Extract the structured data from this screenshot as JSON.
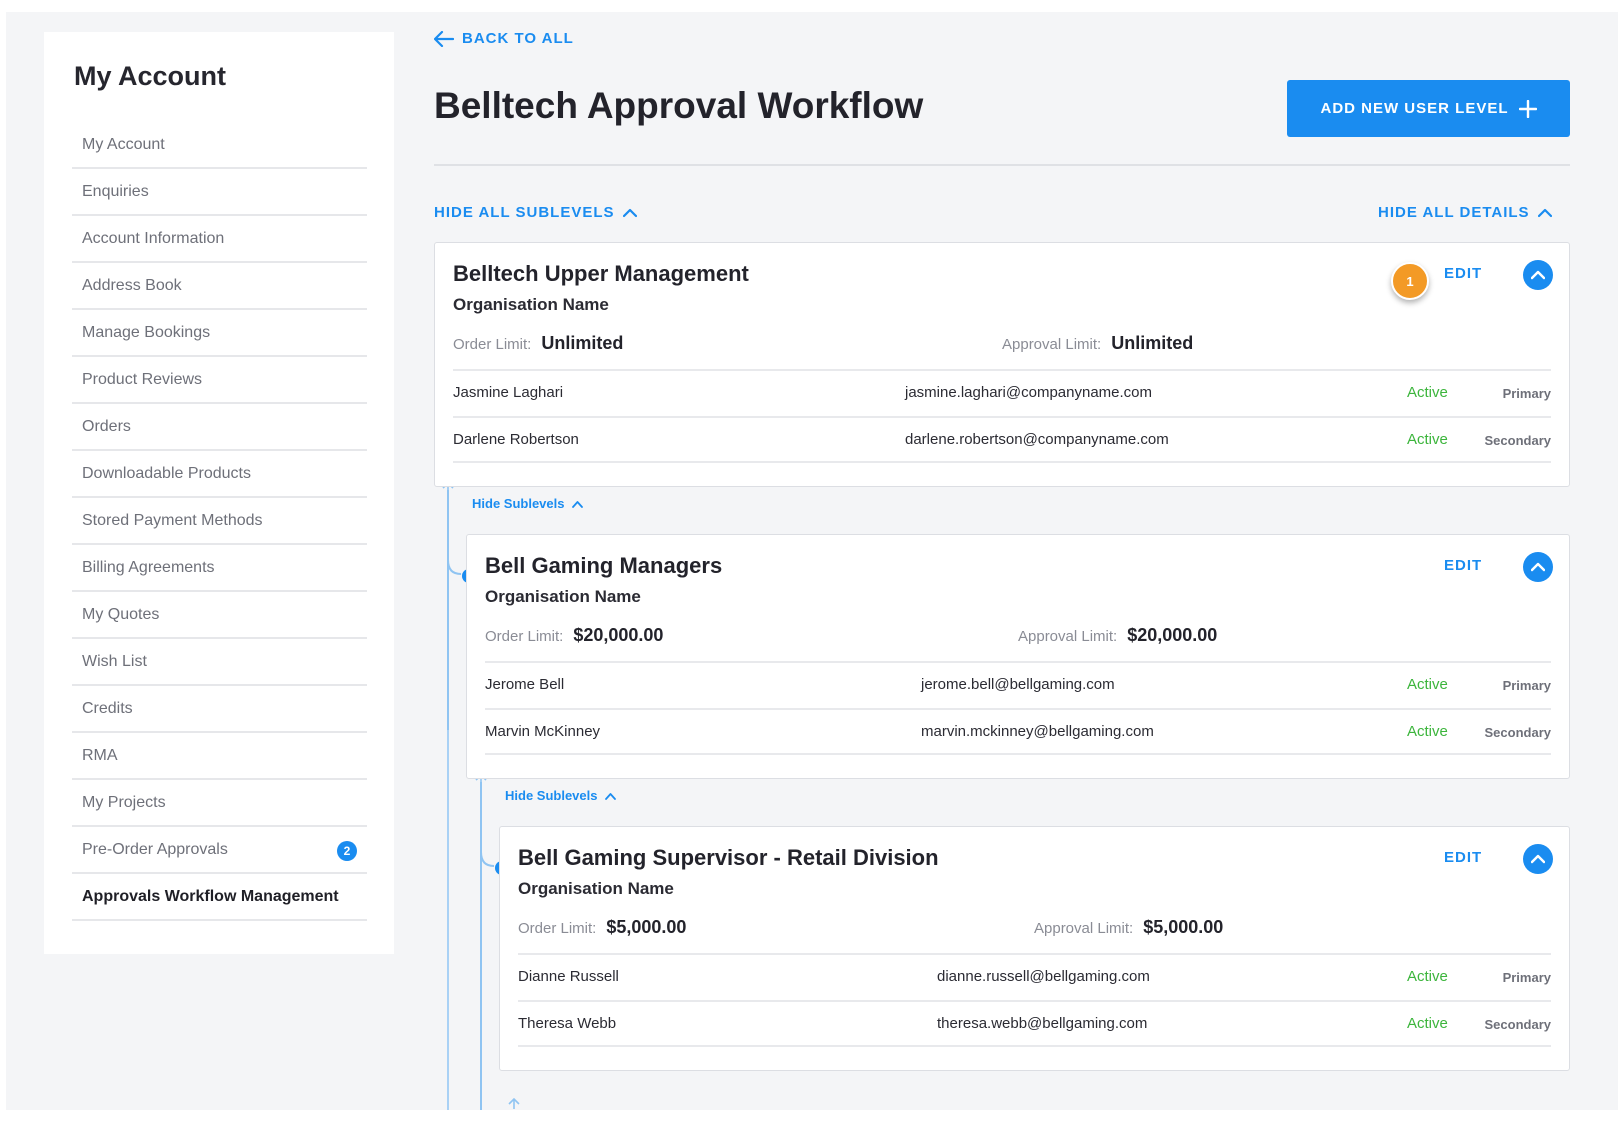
{
  "sidebar": {
    "title": "My Account",
    "items": [
      {
        "label": "My Account"
      },
      {
        "label": "Enquiries"
      },
      {
        "label": "Account Information"
      },
      {
        "label": "Address Book"
      },
      {
        "label": "Manage Bookings"
      },
      {
        "label": "Product Reviews"
      },
      {
        "label": "Orders"
      },
      {
        "label": "Downloadable Products"
      },
      {
        "label": "Stored Payment Methods"
      },
      {
        "label": "Billing Agreements"
      },
      {
        "label": "My Quotes"
      },
      {
        "label": "Wish List"
      },
      {
        "label": "Credits"
      },
      {
        "label": "RMA"
      },
      {
        "label": "My Projects"
      },
      {
        "label": "Pre-Order Approvals",
        "badge": "2"
      },
      {
        "label": "Approvals Workflow Management",
        "current": true
      }
    ]
  },
  "header": {
    "back_label": "BACK TO ALL",
    "title": "Belltech Approval Workflow",
    "add_button": "ADD NEW USER LEVEL"
  },
  "toggles": {
    "hide_sublevels": "HIDE ALL SUBLEVELS",
    "hide_details": "HIDE ALL DETAILS"
  },
  "marker": "1",
  "levels": [
    {
      "title": "Belltech Upper Management",
      "org": "Organisation Name",
      "order_label": "Order Limit:",
      "order_value": "Unlimited",
      "approval_label": "Approval Limit:",
      "approval_value": "Unlimited",
      "edit": "EDIT",
      "users": [
        {
          "name": "Jasmine Laghari",
          "email": "jasmine.laghari@companyname.com",
          "status": "Active",
          "role": "Primary"
        },
        {
          "name": "Darlene Robertson",
          "email": "darlene.robertson@companyname.com",
          "status": "Active",
          "role": "Secondary"
        }
      ],
      "sublevel_toggle": "Hide Sublevels"
    },
    {
      "title": "Bell Gaming Managers",
      "org": "Organisation Name",
      "order_label": "Order Limit:",
      "order_value": "$20,000.00",
      "approval_label": "Approval Limit:",
      "approval_value": "$20,000.00",
      "edit": "EDIT",
      "users": [
        {
          "name": "Jerome Bell",
          "email": "jerome.bell@bellgaming.com",
          "status": "Active",
          "role": "Primary"
        },
        {
          "name": "Marvin McKinney",
          "email": "marvin.mckinney@bellgaming.com",
          "status": "Active",
          "role": "Secondary"
        }
      ],
      "sublevel_toggle": "Hide Sublevels"
    },
    {
      "title": "Bell Gaming Supervisor - Retail Division",
      "org": "Organisation Name",
      "order_label": "Order Limit:",
      "order_value": "$5,000.00",
      "approval_label": "Approval Limit:",
      "approval_value": "$5,000.00",
      "edit": "EDIT",
      "users": [
        {
          "name": "Dianne Russell",
          "email": "dianne.russell@bellgaming.com",
          "status": "Active",
          "role": "Primary"
        },
        {
          "name": "Theresa Webb",
          "email": "theresa.webb@bellgaming.com",
          "status": "Active",
          "role": "Secondary"
        }
      ]
    }
  ],
  "colors": {
    "accent": "#1a8cf0",
    "active": "#3cb53c",
    "marker": "#f39a26"
  }
}
